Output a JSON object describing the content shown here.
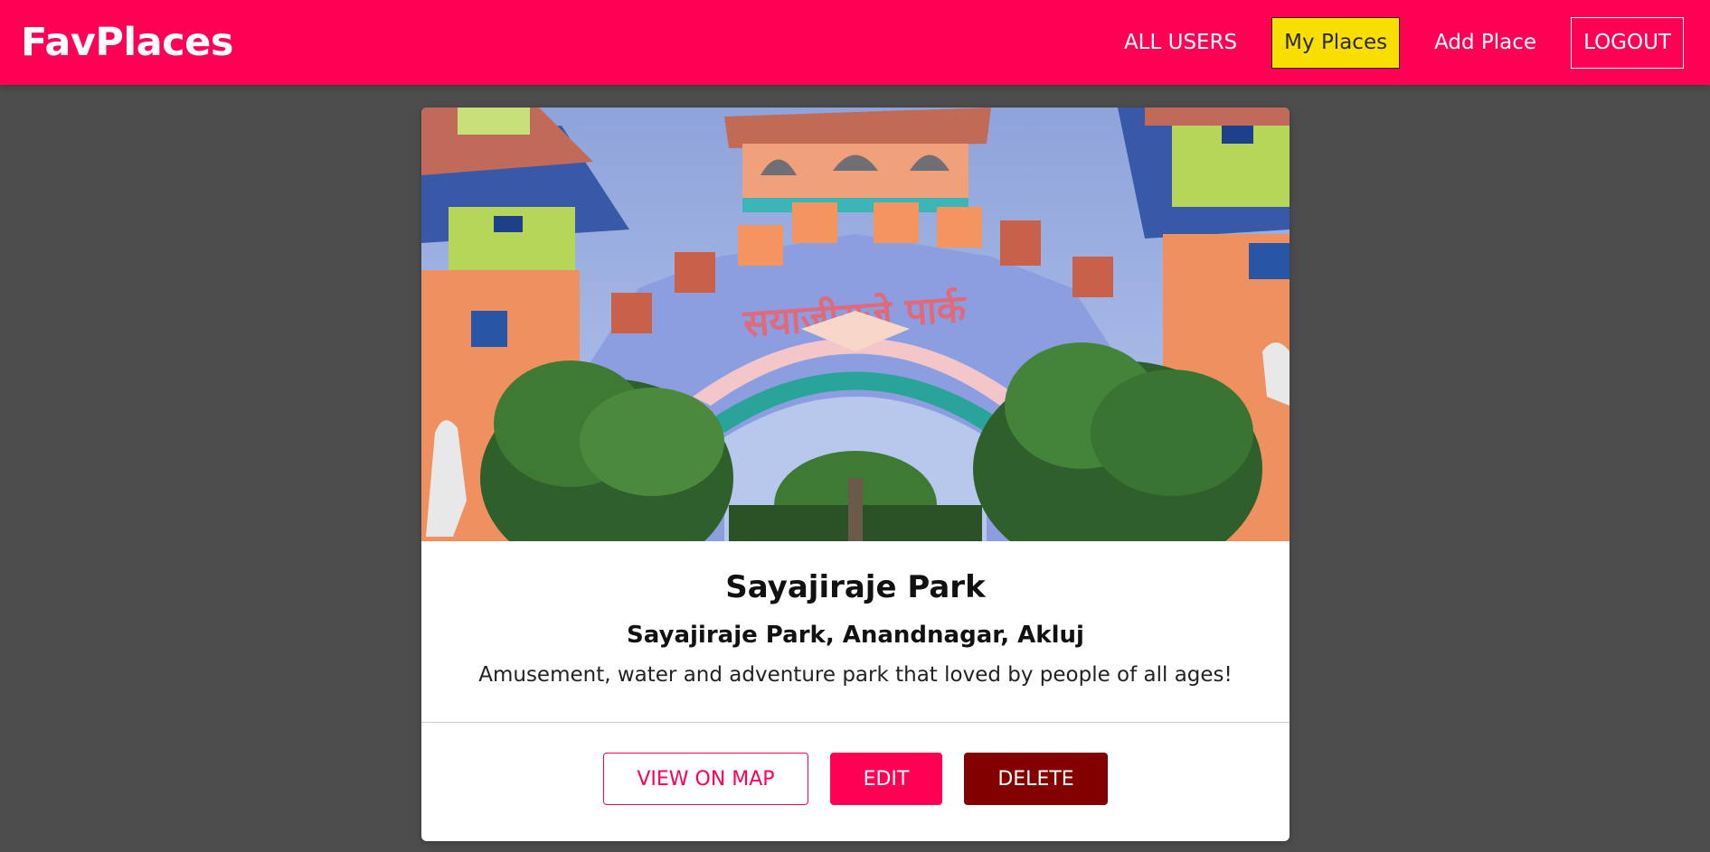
{
  "header": {
    "logo": "FavPlaces",
    "nav": {
      "all_users": "ALL USERS",
      "my_places": "My Places",
      "add_place": "Add Place",
      "logout": "LOGOUT"
    }
  },
  "place": {
    "image_alt": "Sayajiraje Park",
    "gate_sign": "सयाजीराजे पार्क",
    "title": "Sayajiraje Park",
    "address": "Sayajiraje Park, Anandnagar, Akluj",
    "description": "Amusement, water and adventure park that loved by people of all ages!",
    "actions": {
      "view_on_map": "VIEW ON MAP",
      "edit": "EDIT",
      "delete": "DELETE"
    }
  },
  "colors": {
    "brand": "#ff0055",
    "active_nav": "#f8df00",
    "danger": "#830000",
    "background": "#4d4d4d"
  }
}
